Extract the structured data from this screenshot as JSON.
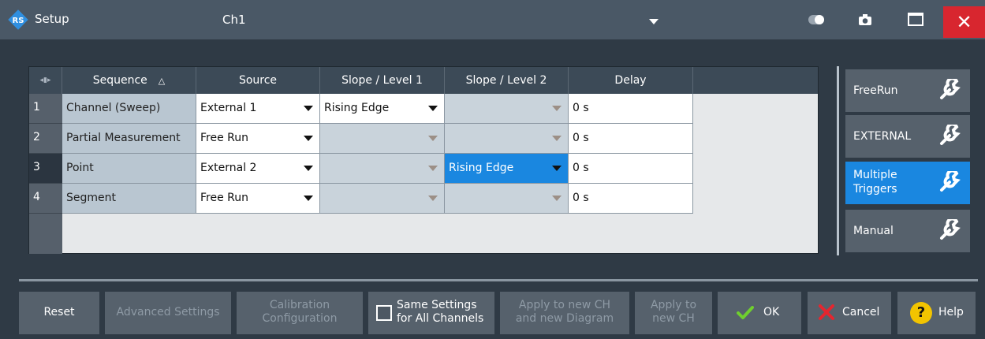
{
  "window": {
    "title": "Setup",
    "channel": "Ch1",
    "close_label": "✕"
  },
  "table": {
    "headers": {
      "corner": "◂▮▸",
      "sequence": "Sequence",
      "sort_indicator": "△",
      "source": "Source",
      "slope1": "Slope / Level 1",
      "slope2": "Slope / Level 2",
      "delay": "Delay"
    },
    "rows": [
      {
        "num": "1",
        "sequence": "Channel (Sweep)",
        "source": "External 1",
        "slope1": "Rising Edge",
        "slope2": "",
        "delay": "0 s"
      },
      {
        "num": "2",
        "sequence": "Partial Measurement",
        "source": "Free Run",
        "slope1": "",
        "slope2": "",
        "delay": "0 s"
      },
      {
        "num": "3",
        "sequence": "Point",
        "source": "External 2",
        "slope1": "",
        "slope2": "Rising Edge",
        "delay": "0 s"
      },
      {
        "num": "4",
        "sequence": "Segment",
        "source": "Free Run",
        "slope1": "",
        "slope2": "",
        "delay": "0 s"
      }
    ]
  },
  "side_buttons": {
    "freerun": "FreeRun",
    "external": "EXTERNAL",
    "multiple_1": "Multiple",
    "multiple_2": "Triggers",
    "manual": "Manual"
  },
  "bottom_buttons": {
    "reset": "Reset",
    "advanced": "Advanced Settings",
    "calib_1": "Calibration",
    "calib_2": "Configuration",
    "same_1": "Same Settings",
    "same_2": "for All Channels",
    "apply_new_ch_diag_1": "Apply to new CH",
    "apply_new_ch_diag_2": "and new Diagram",
    "apply_new_ch_1": "Apply to",
    "apply_new_ch_2": "new CH",
    "ok": "OK",
    "cancel": "Cancel",
    "help": "Help",
    "help_glyph": "?"
  },
  "colors": {
    "accent": "#1a87e0",
    "close": "#d8262f",
    "help": "#f2c400",
    "ok_check": "#6fcf2e"
  }
}
